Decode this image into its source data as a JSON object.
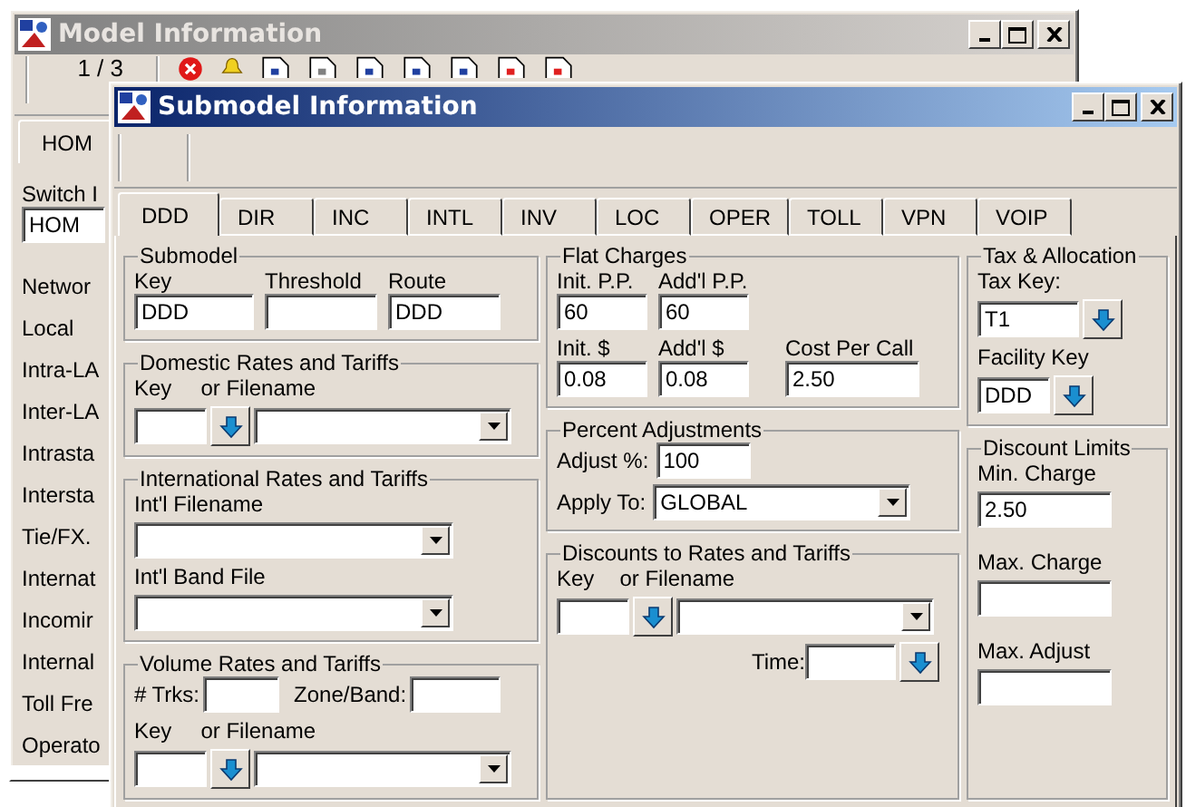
{
  "model_window": {
    "title": "Model Information",
    "record_counter": "1 / 3",
    "tabs": [
      {
        "label": "HOM",
        "selected": true
      }
    ],
    "switch_label": "Switch I",
    "switch_value": "HOM",
    "list_items": [
      "Networ",
      "Local",
      "Intra-LA",
      "Inter-LA",
      "Intrasta",
      "Intersta",
      "Tie/FX.",
      "Internat",
      "Incomir",
      "Internal",
      "Toll Fre",
      "Operato"
    ]
  },
  "submodel_window": {
    "title": "Submodel Information",
    "tabs": [
      {
        "label": "DDD",
        "selected": true
      },
      {
        "label": "DIR",
        "selected": false
      },
      {
        "label": "INC",
        "selected": false
      },
      {
        "label": "INTL",
        "selected": false
      },
      {
        "label": "INV",
        "selected": false
      },
      {
        "label": "LOC",
        "selected": false
      },
      {
        "label": "OPER",
        "selected": false
      },
      {
        "label": "TOLL",
        "selected": false
      },
      {
        "label": "VPN",
        "selected": false
      },
      {
        "label": "VOIP",
        "selected": false
      }
    ],
    "submodel": {
      "title": "Submodel",
      "key_label": "Key",
      "key": "DDD",
      "threshold_label": "Threshold",
      "route_label": "Route",
      "route": "DDD"
    },
    "domestic": {
      "title": "Domestic Rates and Tariffs",
      "key_label": "Key",
      "filename_label": "or Filename"
    },
    "international": {
      "title": "International Rates and Tariffs",
      "filename_label": "Int'l Filename",
      "band_label": "Int'l Band File"
    },
    "volume": {
      "title": "Volume Rates and Tariffs",
      "trunks_label": "# Trks:",
      "zone_label": "Zone/Band:",
      "key_label": "Key",
      "filename_label": "or Filename"
    },
    "flat_charges": {
      "title": "Flat Charges",
      "init_pp_label": "Init. P.P.",
      "init_pp": "60",
      "addl_pp_label": "Add'l P.P.",
      "addl_pp": "60",
      "init_dollar_label": "Init. $",
      "init_dollar": "0.08",
      "addl_dollar_label": "Add'l $",
      "addl_dollar": "0.08",
      "cost_label": "Cost Per Call",
      "cost": "2.50"
    },
    "percent": {
      "title": "Percent Adjustments",
      "adjust_label": "Adjust %:",
      "adjust": "100",
      "apply_label": "Apply To:",
      "apply": "GLOBAL"
    },
    "discounts": {
      "title": "Discounts to Rates and Tariffs",
      "key_label": "Key",
      "filename_label": "or Filename",
      "time_label": "Time:"
    },
    "tax": {
      "title": "Tax & Allocation",
      "tax_key_label": "Tax Key:",
      "tax_key": "T1",
      "facility_label": "Facility Key",
      "facility_key": "DDD"
    },
    "limits": {
      "title": "Discount Limits",
      "min_label": "Min. Charge",
      "min": "2.50",
      "max_label": "Max. Charge",
      "max_adjust_label": "Max. Adjust"
    }
  }
}
